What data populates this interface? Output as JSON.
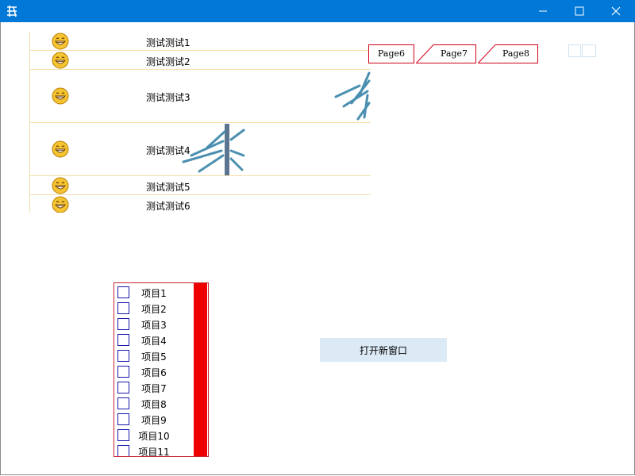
{
  "list": {
    "items": [
      {
        "label": "测试测试1",
        "icon": "grin-smiley-icon"
      },
      {
        "label": "测试测试2",
        "icon": "grin-smiley-icon"
      },
      {
        "label": "测试测试3",
        "icon": "grin-smiley-icon"
      },
      {
        "label": "测试测试4",
        "icon": "grin-smiley-icon"
      },
      {
        "label": "测试测试5",
        "icon": "grin-smiley-icon"
      },
      {
        "label": "测试测试6",
        "icon": "grin-smiley-icon"
      }
    ]
  },
  "tabs": [
    {
      "label": "Page6"
    },
    {
      "label": "Page7"
    },
    {
      "label": "Page8"
    }
  ],
  "checklist": {
    "items": [
      "项目1",
      "项目2",
      "项目3",
      "项目4",
      "项目5",
      "项目6",
      "项目7",
      "项目8",
      "项目9",
      "项目10",
      "项目11"
    ]
  },
  "open_button": {
    "label": "打开新窗口"
  },
  "colors": {
    "titlebar": "#0078d7",
    "row_divider": "#f5dfa9",
    "tab_border": "#d0021b",
    "checklist_border": "#c82333",
    "scrollbar": "#ee0000",
    "button_bg": "#dceaf5"
  }
}
